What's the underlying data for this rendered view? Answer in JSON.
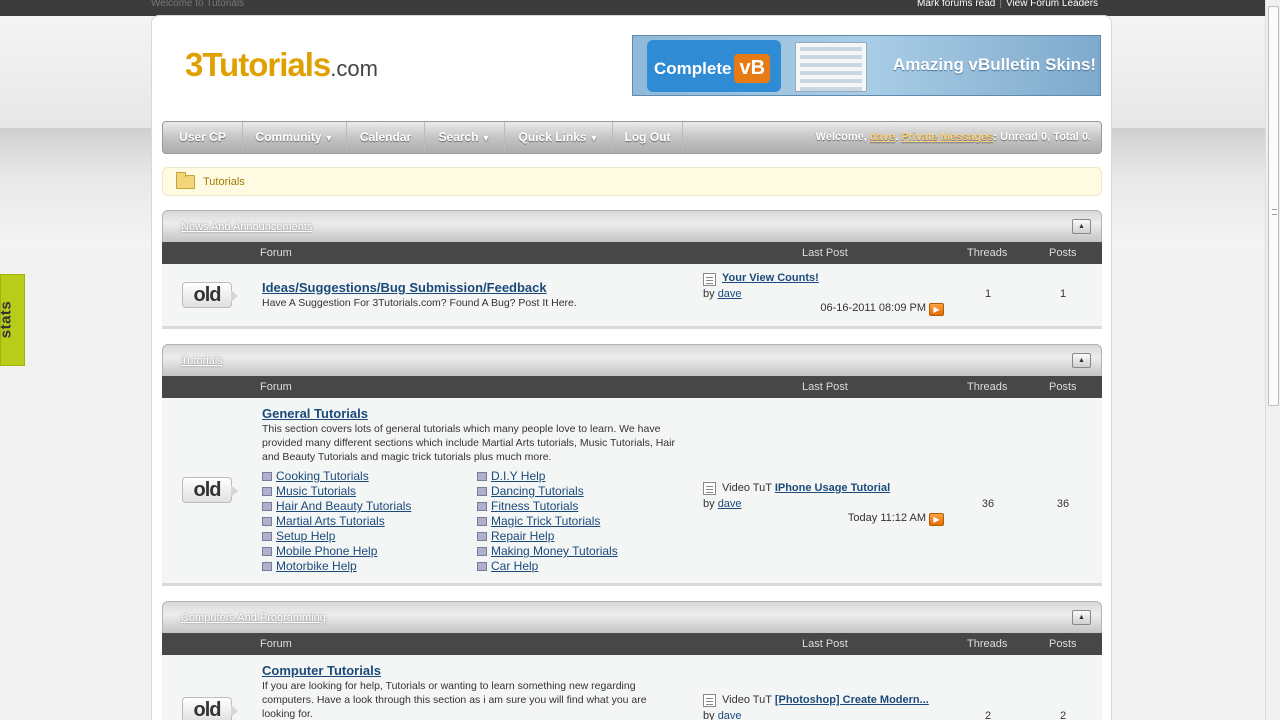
{
  "top_bar": {
    "welcome_text": "Welcome to Tutorials",
    "mark_read": "Mark forums read",
    "separator": "|",
    "forum_leaders": "View Forum Leaders"
  },
  "stats_tab": "stats",
  "logo": {
    "brand": "3Tutorials",
    "tld": ".com"
  },
  "banner": {
    "left_text": "Complete",
    "badge": "vB",
    "right_text": "Amazing vBulletin Skins!"
  },
  "nav": {
    "items": [
      "User CP",
      "Community",
      "Calendar",
      "Search",
      "Quick Links",
      "Log Out"
    ],
    "welcome_prefix": "Welcome,",
    "username": "dave",
    "pm_label": "Private Messages",
    "pm_counts": ": Unread 0, Total 0."
  },
  "breadcrumb": "Tutorials",
  "columns": {
    "forum": "Forum",
    "last_post": "Last Post",
    "threads": "Threads",
    "posts": "Posts"
  },
  "categories": [
    {
      "title": "News And Announcements",
      "forum": {
        "icon_label": "old",
        "title": "Ideas/Suggestions/Bug Submission/Feedback",
        "desc": "Have A Suggestion For 3Tutorials.com? Found A Bug? Post It Here.",
        "last_post_prefix": "",
        "last_post_title": "Your View Counts!",
        "by": "by",
        "last_post_user": "dave",
        "last_post_date": "06-16-2011",
        "last_post_time": "08:09 PM",
        "threads": "1",
        "posts": "1"
      }
    },
    {
      "title": "Tutorials",
      "forum": {
        "icon_label": "old",
        "title": "General Tutorials",
        "desc": "This section covers lots of general tutorials which many people love to learn. We have provided many different sections which include Martial Arts tutorials, Music Tutorials, Hair and Beauty Tutorials and magic trick tutorials plus much more.",
        "subforums_left": [
          "Cooking Tutorials",
          "Music Tutorials",
          "Hair And Beauty Tutorials",
          "Martial Arts Tutorials",
          "Setup Help",
          "Mobile Phone Help",
          "Motorbike Help"
        ],
        "subforums_right": [
          "D.I.Y Help",
          "Dancing Tutorials",
          "Fitness Tutorials",
          "Magic Trick Tutorials",
          "Repair Help",
          "Making Money Tutorials",
          "Car Help"
        ],
        "last_post_prefix": "Video TuT",
        "last_post_title": "IPhone Usage Tutorial",
        "by": "by",
        "last_post_user": "dave",
        "last_post_date": "Today",
        "last_post_time": "11:12 AM",
        "threads": "36",
        "posts": "36"
      }
    },
    {
      "title": "Computers And Programming",
      "forum": {
        "icon_label": "old",
        "title": "Computer Tutorials",
        "desc": "If you are looking for help, Tutorials or wanting to learn something new regarding computers. Have a look through this section as i am sure you will find what you are looking for.",
        "last_post_prefix": "Video TuT",
        "last_post_title": "[Photoshop] Create Modern...",
        "by": "by",
        "last_post_user": "dave",
        "threads": "2",
        "posts": "2"
      }
    }
  ]
}
